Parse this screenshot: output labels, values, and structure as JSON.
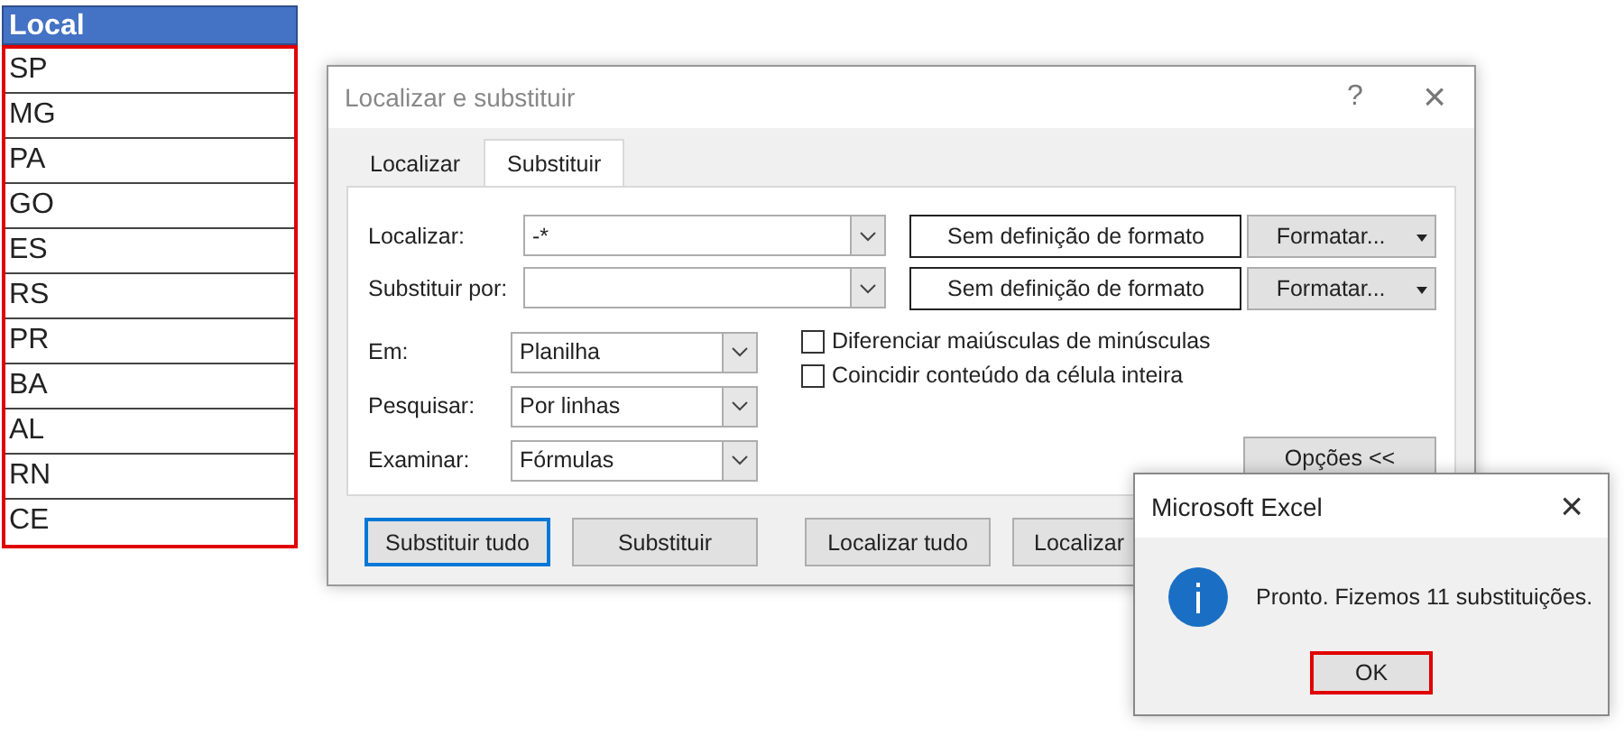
{
  "sheet": {
    "header": "Local",
    "highlighted": true,
    "rows": [
      "SP",
      "MG",
      "PA",
      "GO",
      "ES",
      "RS",
      "PR",
      "BA",
      "AL",
      "RN",
      "CE"
    ]
  },
  "dialog": {
    "title": "Localizar e substituir",
    "help": "?",
    "close": "×",
    "tabs": [
      {
        "label": "Localizar",
        "selected": false
      },
      {
        "label": "Substituir",
        "selected": true
      }
    ],
    "fields": [
      {
        "label": "Localizar:",
        "value": "-*",
        "format": "Sem definição de formato",
        "format_button": "Formatar..."
      },
      {
        "label": "Substituir por:",
        "format": "Sem definição de formato",
        "format_button": "Formatar..."
      }
    ],
    "selects": [
      {
        "label": "Em:",
        "value": "Planilha"
      },
      {
        "label": "Pesquisar:",
        "value": "Por linhas"
      },
      {
        "label": "Examinar:",
        "value": "Fórmulas"
      }
    ],
    "checkboxes": [
      {
        "label": "Diferenciar maiúsculas de minúsculas",
        "checked": false
      },
      {
        "label": "Coincidir conteúdo da célula inteira",
        "checked": false
      }
    ],
    "options_button": "Opções <<",
    "buttons": [
      {
        "label": "Substituir tudo",
        "focused": true
      },
      {
        "label": "Substituir",
        "focused": false
      },
      {
        "label": "Localizar tudo",
        "focused": false
      },
      {
        "label": "Localizar",
        "focused": false
      }
    ]
  },
  "message": {
    "title": "Microsoft Excel",
    "close": "×",
    "text": "Pronto. Fizemos 11 substituições.",
    "button": {
      "label": "OK",
      "highlighted": true
    }
  }
}
